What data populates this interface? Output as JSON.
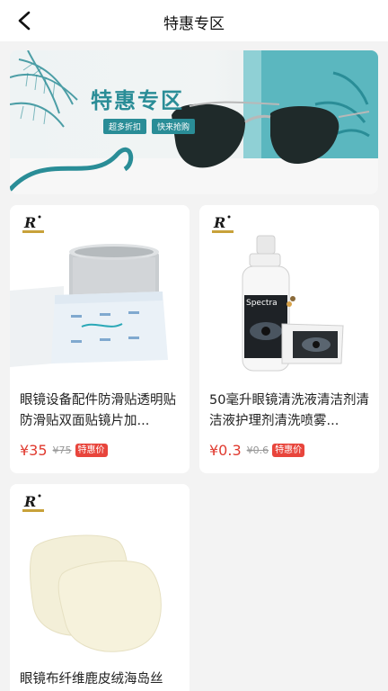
{
  "header": {
    "title": "特惠专区",
    "back_icon": "chevron-left-icon"
  },
  "banner": {
    "heading": "特惠专区",
    "tags": [
      "超多折扣",
      "快来抢购"
    ]
  },
  "products": [
    {
      "name": "眼镜设备配件防滑贴透明贴防滑贴双面贴镜片加...",
      "price": "¥35",
      "original_price": "¥75",
      "badge": "特惠价"
    },
    {
      "name": "50毫升眼镜清洗液清洁剂清洁液护理剂清洗喷雾...",
      "price": "¥0.3",
      "original_price": "¥0.6",
      "badge": "特惠价",
      "product_label": "Spectra"
    },
    {
      "name": "眼镜布纤维鹿皮绒海岛丝"
    }
  ],
  "colors": {
    "accent_price": "#e03a2f",
    "badge_bg": "#e8453c",
    "banner_teal": "#2a8d97"
  }
}
